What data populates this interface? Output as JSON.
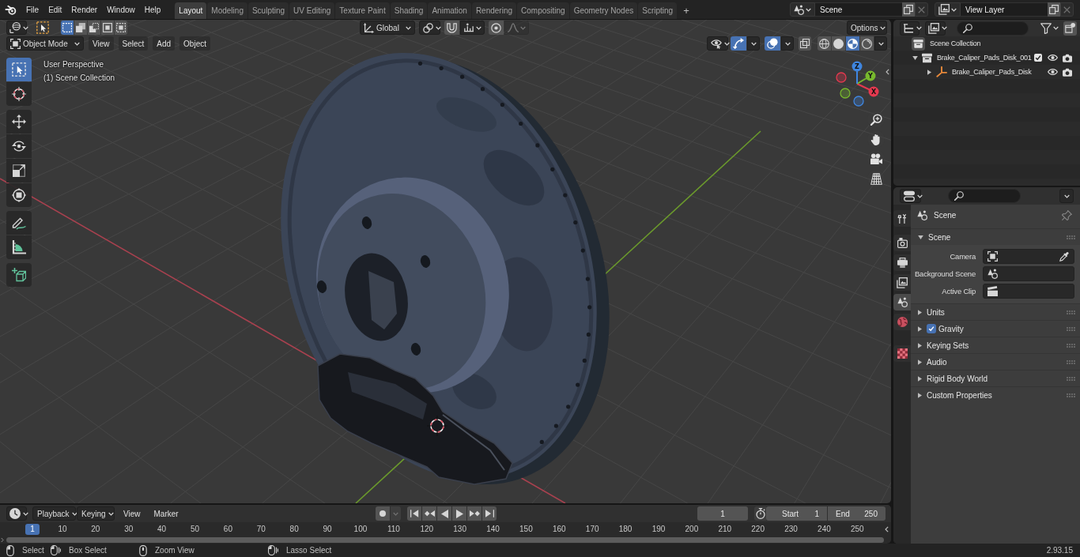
{
  "topbar": {
    "menus": [
      "File",
      "Edit",
      "Render",
      "Window",
      "Help"
    ],
    "workspaces": [
      {
        "label": "Layout",
        "selected": true
      },
      {
        "label": "Modeling",
        "selected": false
      },
      {
        "label": "Sculpting",
        "selected": false
      },
      {
        "label": "UV Editing",
        "selected": false
      },
      {
        "label": "Texture Paint",
        "selected": false
      },
      {
        "label": "Shading",
        "selected": false
      },
      {
        "label": "Animation",
        "selected": false
      },
      {
        "label": "Rendering",
        "selected": false
      },
      {
        "label": "Compositing",
        "selected": false
      },
      {
        "label": "Geometry Nodes",
        "selected": false
      },
      {
        "label": "Scripting",
        "selected": false
      }
    ],
    "add_workspace": "+",
    "scene": "Scene",
    "view_layer": "View Layer"
  },
  "viewport": {
    "tool_settings": {
      "select_modes": [
        {
          "kind": "new",
          "selected": true
        },
        {
          "kind": "extend",
          "selected": false
        },
        {
          "kind": "subtract",
          "selected": false
        },
        {
          "kind": "invert",
          "selected": false
        },
        {
          "kind": "intersect",
          "selected": false
        }
      ],
      "orientation": "Global",
      "snap": {
        "on": false
      },
      "proportional": {
        "on": false
      },
      "options": "Options"
    },
    "header": {
      "mode": "Object Mode",
      "menus": [
        "View",
        "Select",
        "Add",
        "Object"
      ],
      "gizmos": {
        "on": true
      },
      "overlays": {
        "on": true
      },
      "xray": {
        "on": false
      },
      "shading_modes": [
        {
          "kind": "wireframe",
          "selected": false
        },
        {
          "kind": "solid",
          "selected": false
        },
        {
          "kind": "material",
          "selected": true
        },
        {
          "kind": "rendered",
          "selected": false
        }
      ]
    },
    "info": [
      "User Perspective",
      "(1) Scene Collection"
    ],
    "tool_groups": [
      {
        "tools": [
          {
            "kind": "select",
            "selected": true
          },
          {
            "kind": "cursor",
            "selected": false
          }
        ]
      },
      {
        "tools": [
          {
            "kind": "move",
            "selected": false
          },
          {
            "kind": "rotate",
            "selected": false
          },
          {
            "kind": "scale",
            "selected": false
          },
          {
            "kind": "transform",
            "selected": false
          }
        ]
      },
      {
        "tools": [
          {
            "kind": "annotate",
            "selected": false
          },
          {
            "kind": "measure",
            "selected": false
          }
        ]
      },
      {
        "tools": [
          {
            "kind": "add_cube",
            "selected": false
          }
        ]
      }
    ],
    "nav_gizmo": {
      "axes": [
        {
          "label": "X",
          "color": "#e5394f"
        },
        {
          "label": "Y",
          "color": "#77b82d"
        },
        {
          "label": "Z",
          "color": "#3f86e0"
        }
      ]
    }
  },
  "timeline": {
    "menus": [
      {
        "label": "Playback",
        "kind": "dropdown"
      },
      {
        "label": "Keying",
        "kind": "dropdown"
      },
      {
        "label": "View",
        "kind": "menu"
      },
      {
        "label": "Marker",
        "kind": "menu"
      }
    ],
    "auto_keying": {
      "on": false
    },
    "current_frame": "1",
    "start": {
      "label": "Start",
      "value": "1"
    },
    "end": {
      "label": "End",
      "value": "250"
    },
    "ruler": {
      "playhead": "1",
      "ticks": [
        "10",
        "20",
        "30",
        "40",
        "50",
        "60",
        "70",
        "80",
        "90",
        "100",
        "110",
        "120",
        "130",
        "140",
        "150",
        "160",
        "170",
        "180",
        "190",
        "200",
        "210",
        "220",
        "230",
        "240",
        "250"
      ]
    }
  },
  "outliner": {
    "tree": [
      {
        "label": "Scene Collection",
        "kind": "scene_collection",
        "children": [
          {
            "label": "Brake_Caliper_Pads_Disk_001",
            "kind": "collection",
            "expanded": true,
            "checked": true,
            "visible": true,
            "renderable": true,
            "children": [
              {
                "label": "Brake_Caliper_Pads_Disk",
                "kind": "empty",
                "expanded": false,
                "visible": true,
                "renderable": true
              }
            ]
          }
        ]
      }
    ]
  },
  "properties": {
    "tab_groups": [
      {
        "tabs": [
          {
            "kind": "tool",
            "selected": false
          }
        ]
      },
      {
        "tabs": [
          {
            "kind": "render",
            "selected": false
          },
          {
            "kind": "output",
            "selected": false
          },
          {
            "kind": "view_layer",
            "selected": false
          },
          {
            "kind": "scene",
            "selected": true
          },
          {
            "kind": "world",
            "selected": false
          }
        ]
      },
      {
        "tabs": [
          {
            "kind": "texture",
            "selected": false
          }
        ]
      }
    ],
    "context": "Scene",
    "panels": [
      {
        "title": "Scene",
        "kind": "panel",
        "expanded": true,
        "fields": [
          {
            "label": "Camera",
            "kind": "camera"
          },
          {
            "label": "Background Scene",
            "kind": "scene"
          },
          {
            "label": "Active Clip",
            "kind": "clip"
          }
        ]
      },
      {
        "title": "Units",
        "kind": "panel",
        "expanded": false
      },
      {
        "title": "Gravity",
        "kind": "toggle_panel",
        "expanded": false,
        "checked": true
      },
      {
        "title": "Keying Sets",
        "kind": "panel",
        "expanded": false
      },
      {
        "title": "Audio",
        "kind": "panel",
        "expanded": false
      },
      {
        "title": "Rigid Body World",
        "kind": "panel",
        "expanded": false
      },
      {
        "title": "Custom Properties",
        "kind": "panel",
        "expanded": false
      }
    ]
  },
  "status_bar": {
    "hints": [
      {
        "kind": "click",
        "label": "Select"
      },
      {
        "kind": "drag",
        "label": "Box Select"
      },
      {
        "kind": "middle",
        "label": "Zoom View"
      },
      {
        "kind": "drag",
        "label": "Lasso Select"
      }
    ],
    "version": "2.93.15"
  }
}
